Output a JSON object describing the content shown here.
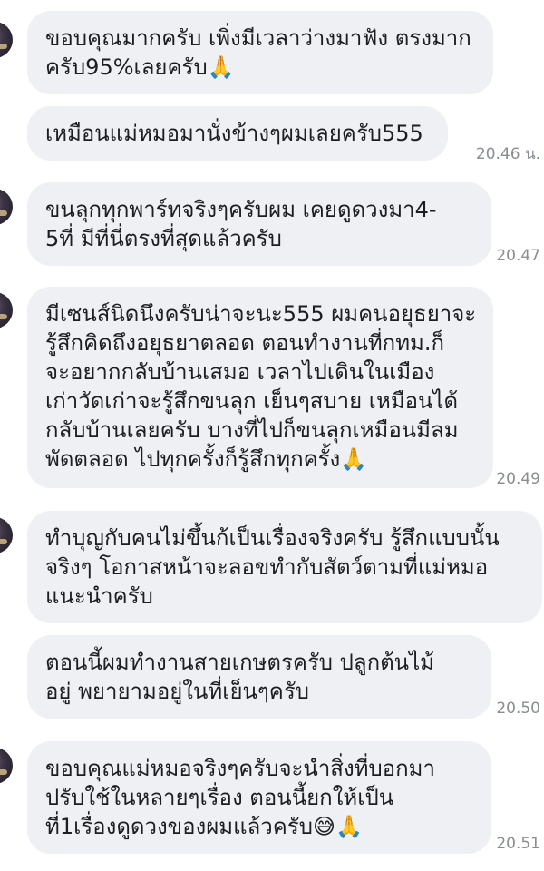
{
  "messages": [
    {
      "lines": [
        "ขอบคุณมากครับ เพิ่งมีเวลาว่างมาฟัง ตรงมาก",
        "ครับ95%เลยครับ🙏"
      ],
      "time": ""
    },
    {
      "lines": [
        "เหมือนแม่หมอมานั่งข้างๆผมเลยครับ555"
      ],
      "time": "20.46 น."
    },
    {
      "lines": [
        "ขนลุกทุกพาร์ทจริงๆครับผม เคยดูดวงมา4-",
        "5ที่ มีที่นี่ตรงที่สุดแล้วครับ"
      ],
      "time": "20.47"
    },
    {
      "lines": [
        "มีเซนส์นิดนึงครับน่าจะนะ555 ผมคนอยุธยาจะ",
        "รู้สึกคิดถึงอยุธยาตลอด ตอนทำงานที่กทม.ก็",
        "จะอยากกลับบ้านเสมอ เวลาไปเดินในเมือง",
        "เก่าวัดเก่าจะรู้สึกขนลุก เย็นๆสบาย เหมือนได้",
        "กลับบ้านเลยครับ บางที่ไปก็ขนลุกเหมือนมีลม",
        "พัดตลอด ไปทุกครั้งก็รู้สึกทุกครั้ง🙏"
      ],
      "time": "20.49"
    },
    {
      "lines": [
        "ทำบุญกับคนไม่ขึ้นก้เป็นเรื่องจริงครับ รู้สึกแบบนั้น",
        "จริงๆ โอกาสหน้าจะลอขทำกับสัตว์ตามที่แม่หมอ",
        "แนะนำครับ"
      ],
      "time": ""
    },
    {
      "lines": [
        "ตอนนี้ผมทำงานสายเกษตรครับ ปลูกต้นไม้",
        "อยู่ พยายามอยู่ในที่เย็นๆครับ"
      ],
      "time": "20.50"
    },
    {
      "lines": [
        "ขอบคุณแม่หมอจริงๆครับจะนำสิ่งที่บอกมา",
        "ปรับใช้ในหลายๆเรื่อง ตอนนี้ยกให้เป็น",
        "ที่1เรื่องดูดวงของผมแล้วครับ😅🙏"
      ],
      "time": "20.51"
    }
  ]
}
